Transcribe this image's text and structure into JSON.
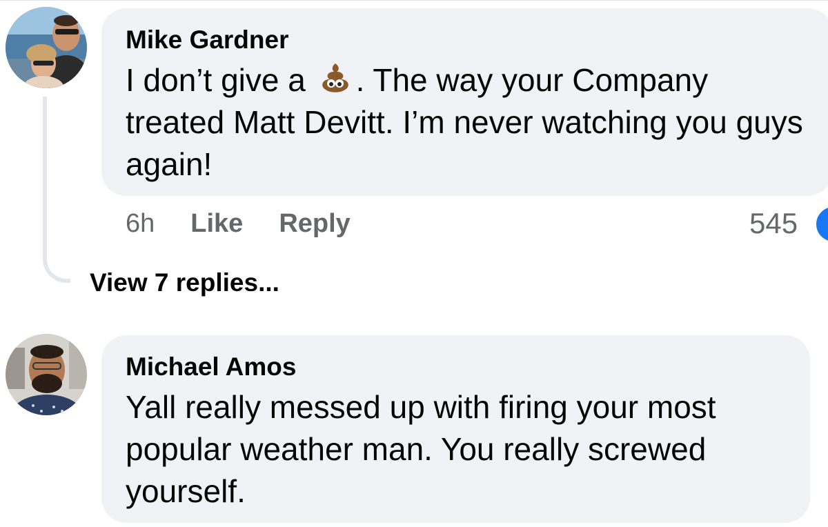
{
  "comments": [
    {
      "author": "Mike Gardner",
      "text_before_emoji": "I don’t give a ",
      "emoji": "poop-emoji",
      "text_after_emoji": ". The way your Company treated Matt Devitt. I’m never watching you guys again!",
      "time": "6h",
      "like_label": "Like",
      "reply_label": "Reply",
      "reaction_count": "545",
      "reaction_color": "#1877f2"
    },
    {
      "author": "Michael Amos",
      "text": "Yall really messed up with firing your most popular weather man. You really screwed yourself."
    }
  ],
  "thread": {
    "view_replies_label": "View 7 replies..."
  },
  "colors": {
    "bubble": "#f0f2f5",
    "secondary_text": "#65676b",
    "thread_line": "#e4e6eb"
  }
}
